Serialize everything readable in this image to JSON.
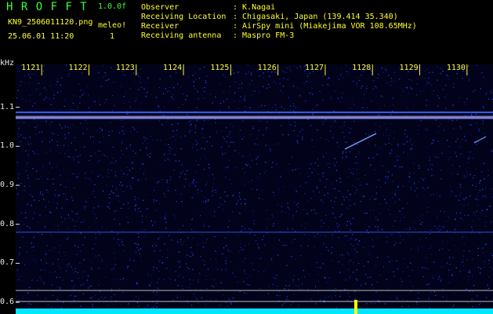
{
  "header": {
    "app_name": "H R O F F T",
    "version": "1.0.0f",
    "filename": "KN9_2506011120.png",
    "datetime": "25.06.01 11:20",
    "meleo_label": "meleo!",
    "meleo_count": "1"
  },
  "info": {
    "observer_label": "Observer",
    "observer_value": ": K.Nagai",
    "location_label": "Receiving Location",
    "location_value": ": Chigasaki, Japan (139.414 35.340)",
    "receiver_label": "Receiver",
    "receiver_value": ": AirSpy mini (Miakejima VOR 108.65MHz)",
    "antenna_label": "Receiving antenna",
    "antenna_value": ": Maspro FM-3"
  },
  "chart_data": {
    "type": "heatmap",
    "ylabel": "kHz",
    "y_ticks": [
      "1.1",
      "1.0",
      "0.9",
      "0.8",
      "0.7",
      "0.6"
    ],
    "y_tick_values": [
      1.1,
      1.0,
      0.9,
      0.8,
      0.7,
      0.6
    ],
    "x_ticks": [
      "1121",
      "1122",
      "1123",
      "1124",
      "1125",
      "1126",
      "1127",
      "1128",
      "1129",
      "1130"
    ],
    "x_tick_values": [
      1121,
      1122,
      1123,
      1124,
      1125,
      1126,
      1127,
      1128,
      1129,
      1130
    ],
    "y_range": [
      0.57,
      1.21
    ],
    "x_range": [
      1120.45,
      1130.55
    ],
    "carrier_lines_khz": [
      1.087,
      1.074,
      0.78
    ],
    "colors": {
      "background": "#02021a",
      "noise": "#1e3cff",
      "carrier": "#ff6464",
      "marker": "#ffff00",
      "spectrum": "#00e5ff",
      "tick_label": "#ffff2a",
      "header_text": "#3cff3c",
      "info_text": "#ffff2a"
    }
  }
}
